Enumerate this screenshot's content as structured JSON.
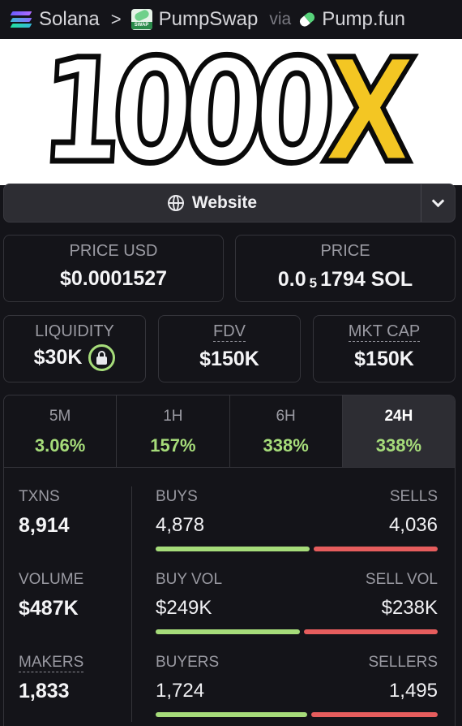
{
  "breadcrumb": {
    "chain": "Solana",
    "separator": ">",
    "dex": "PumpSwap",
    "via_label": "via",
    "launchpad": "Pump.fun",
    "swap_badge": "SWAP"
  },
  "banner": {
    "main": "1000",
    "accent": "X"
  },
  "website_button": {
    "label": "Website"
  },
  "price_usd": {
    "label": "PRICE USD",
    "value": "$0.0001527"
  },
  "price_native": {
    "label": "PRICE",
    "prefix": "0.0",
    "zero_count": "5",
    "suffix": "1794 SOL"
  },
  "liquidity": {
    "label": "LIQUIDITY",
    "value": "$30K"
  },
  "fdv": {
    "label": "FDV",
    "value": "$150K"
  },
  "mkt_cap": {
    "label": "MKT CAP",
    "value": "$150K"
  },
  "tabs": [
    {
      "label": "5M",
      "change": "3.06%"
    },
    {
      "label": "1H",
      "change": "157%"
    },
    {
      "label": "6H",
      "change": "338%"
    },
    {
      "label": "24H",
      "change": "338%"
    }
  ],
  "active_tab": "24H",
  "txns": {
    "label": "TXNS",
    "value": "8,914",
    "buys_label": "BUYS",
    "buys": "4,878",
    "sells_label": "SELLS",
    "sells": "4,036",
    "buy_share": 0.547
  },
  "volume": {
    "label": "VOLUME",
    "value": "$487K",
    "buy_label": "BUY VOL",
    "buy": "$249K",
    "sell_label": "SELL VOL",
    "sell": "$238K",
    "buy_share": 0.511
  },
  "makers": {
    "label": "MAKERS",
    "value": "1,833",
    "buyers_label": "BUYERS",
    "buyers": "1,724",
    "sellers_label": "SELLERS",
    "sellers": "1,495",
    "buy_share": 0.536
  },
  "colors": {
    "positive": "#a6dc7a",
    "negative": "#e65d5d",
    "accent_yellow": "#f3c623",
    "background": "#141419"
  }
}
